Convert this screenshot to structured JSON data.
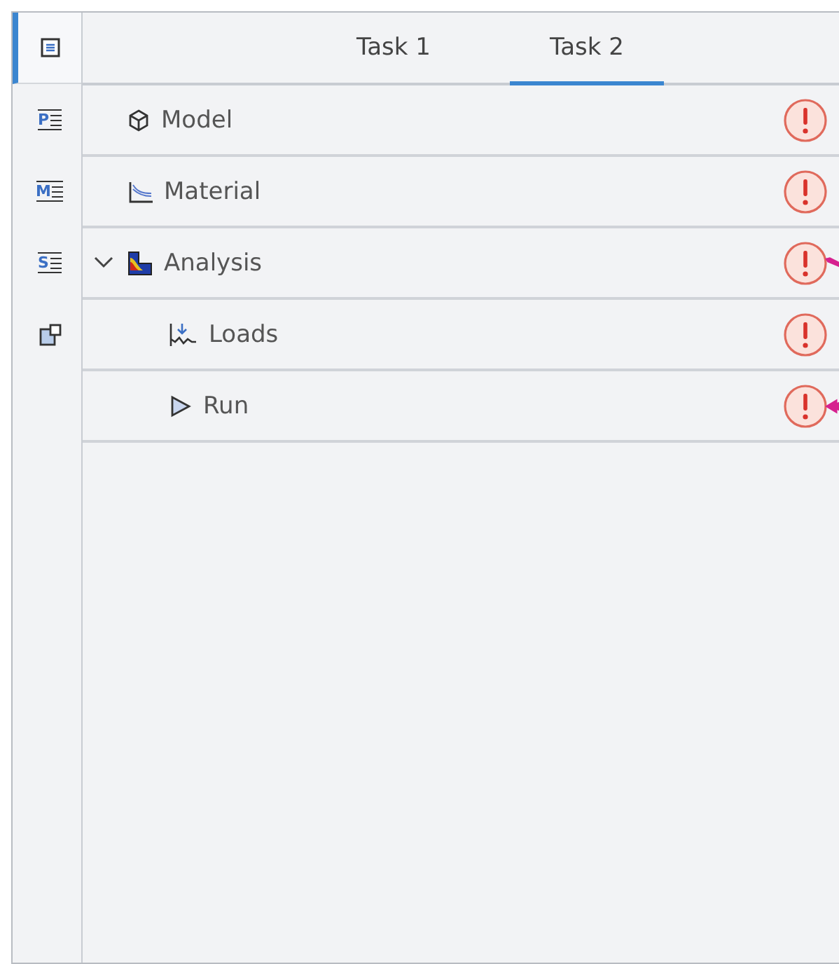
{
  "sidebar": {
    "items": [
      {
        "kind": "document",
        "selected": true
      },
      {
        "kind": "list",
        "letter": "P",
        "selected": false
      },
      {
        "kind": "list",
        "letter": "M",
        "selected": false
      },
      {
        "kind": "list",
        "letter": "S",
        "selected": false
      },
      {
        "kind": "windows",
        "selected": false
      }
    ]
  },
  "tabs": [
    {
      "label": "Task 1",
      "selected": false
    },
    {
      "label": "Task 2",
      "selected": true
    }
  ],
  "tree": [
    {
      "label": "Model",
      "error": true,
      "annotated": false
    },
    {
      "label": "Material",
      "error": true,
      "annotated": false
    },
    {
      "label": "Analysis",
      "error": true,
      "annotated": true,
      "expanded": true,
      "children": [
        {
          "label": "Loads",
          "error": true,
          "annotated": false
        },
        {
          "label": "Run",
          "error": true,
          "annotated": true
        }
      ]
    }
  ]
}
